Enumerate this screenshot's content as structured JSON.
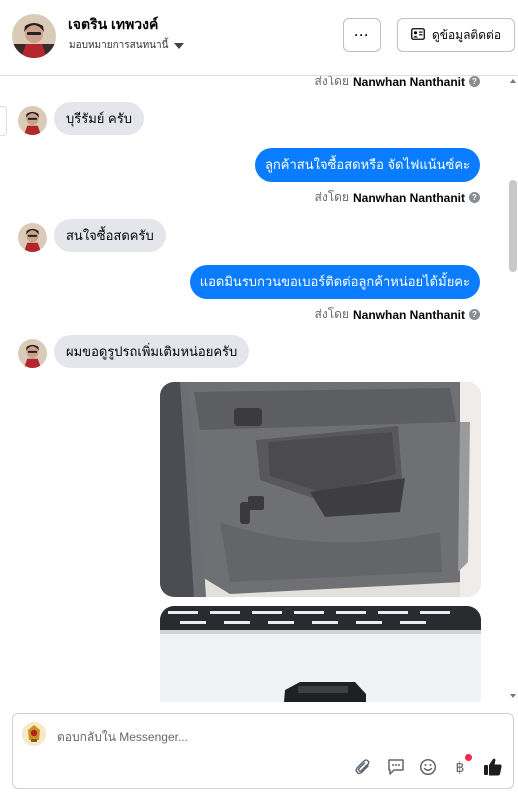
{
  "header": {
    "contact_name": "เจตริน เทพวงค์",
    "assign_label": "มอบหมายการสนทนานี้",
    "more_label": "···",
    "view_contact_label": "ดูข้อมูลติดต่อ"
  },
  "messages": [
    {
      "type": "sent_by",
      "prefix": "ส่งโดย",
      "sender": "Nanwhan Nanthanit"
    },
    {
      "type": "incoming",
      "text": "บุรีรัมย์ ครับ"
    },
    {
      "type": "outgoing",
      "text": "ลูกค้าสนใจซื้อสดหรือ จัดไฟแน้นซ์คะ"
    },
    {
      "type": "sent_by",
      "prefix": "ส่งโดย",
      "sender": "Nanwhan Nanthanit"
    },
    {
      "type": "incoming",
      "text": "สนใจซื้อสดครับ"
    },
    {
      "type": "outgoing",
      "text": "แอดมินรบกวนขอเบอร์ติดต่อลูกค้าหน่อยได้มั้ยคะ"
    },
    {
      "type": "sent_by",
      "prefix": "ส่งโดย",
      "sender": "Nanwhan Nanthanit"
    },
    {
      "type": "incoming",
      "text": "ผมขอดูรูปรถเพิ่มเติมหน่อยครับ"
    },
    {
      "type": "photo",
      "subject": "car-door-interior"
    },
    {
      "type": "photo",
      "subject": "car-showroom"
    }
  ],
  "composer": {
    "placeholder": "ตอบกลับใน Messenger...",
    "icons": [
      "attach-icon",
      "saved-reply-icon",
      "emoji-icon",
      "payment-icon",
      "like-icon"
    ]
  },
  "colors": {
    "outgoing_bubble": "#0a7cff",
    "incoming_bubble": "#e4e6eb",
    "notification_dot": "#f02849"
  }
}
